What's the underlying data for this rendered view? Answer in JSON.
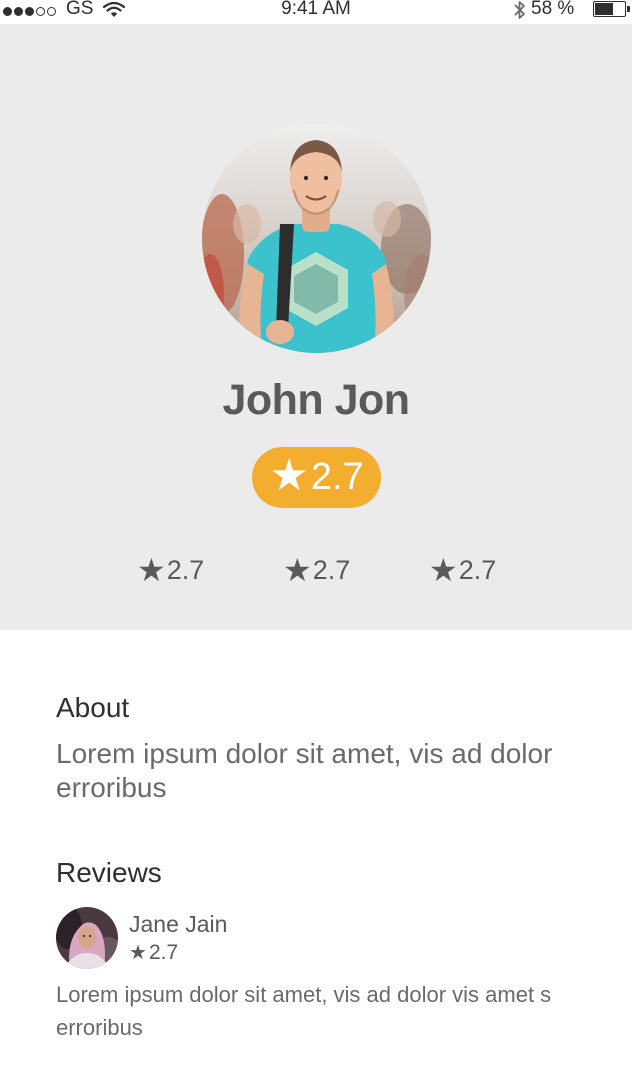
{
  "status_bar": {
    "carrier": "GS",
    "time": "9:41 AM",
    "battery_percent": "58 %",
    "battery_level": 0.58
  },
  "profile": {
    "name": "John Jon",
    "rating": "2.7",
    "sub_ratings": [
      "2.7",
      "2.7",
      "2.7"
    ]
  },
  "about": {
    "title": "About",
    "text": "Lorem ipsum dolor sit amet, vis ad dolor erroribus"
  },
  "reviews": {
    "title": "Reviews",
    "items": [
      {
        "name": "Jane Jain",
        "rating": "2.7",
        "text": "Lorem ipsum dolor sit amet, vis ad dolor vis amet s erroribus"
      }
    ]
  },
  "icons": {
    "star": "star-icon",
    "wifi": "wifi-icon",
    "bluetooth": "bluetooth-icon",
    "battery": "battery-icon"
  },
  "colors": {
    "accent": "#f4ae2f",
    "header_bg": "#ebebeb"
  }
}
